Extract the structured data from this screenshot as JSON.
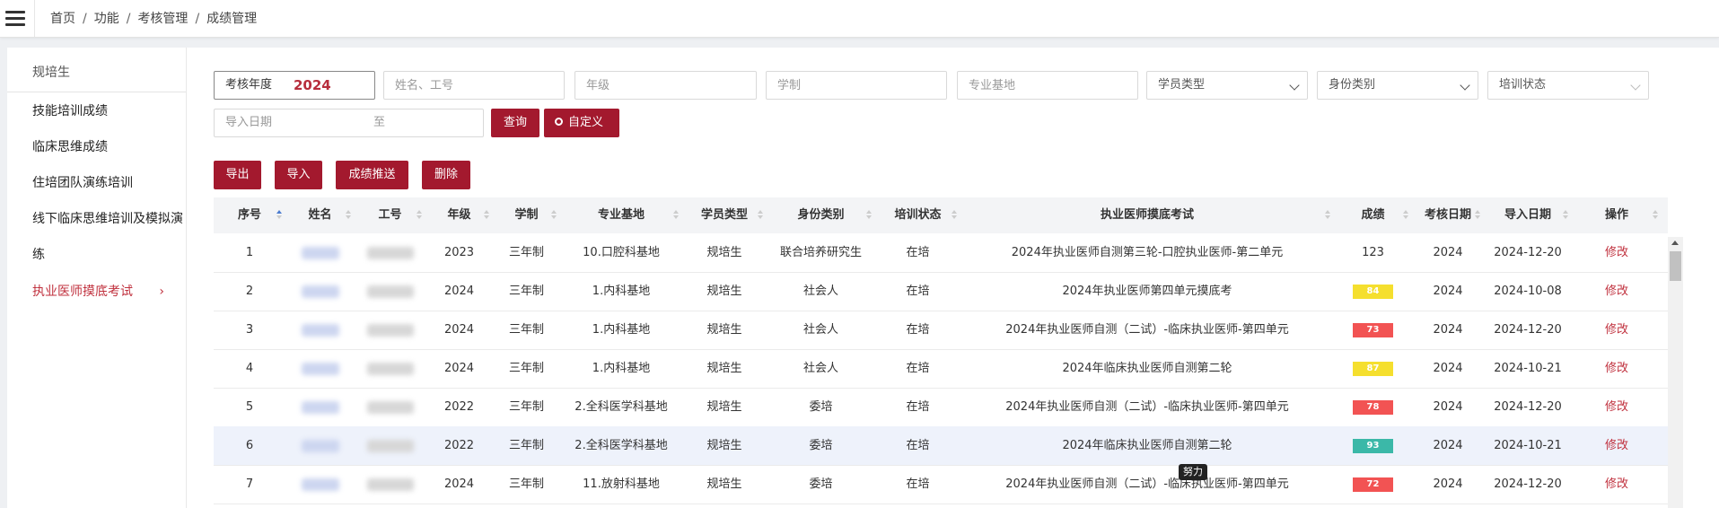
{
  "breadcrumb": [
    "首页",
    "功能",
    "考核管理",
    "成绩管理"
  ],
  "sidebar": {
    "header": "规培生",
    "items": [
      {
        "label": "技能培训成绩"
      },
      {
        "label": "临床思维成绩"
      },
      {
        "label": "住培团队演练培训"
      },
      {
        "label": "线下临床思维培训及模拟演"
      },
      {
        "label": "练"
      },
      {
        "label": "执业医师摸底考试",
        "active": true
      }
    ],
    "chevron": "›"
  },
  "filters": {
    "year_label": "考核年度",
    "year_value": "2024",
    "name_placeholder": "姓名、工号",
    "grade_placeholder": "年级",
    "system_placeholder": "学制",
    "base_placeholder": "专业基地",
    "student_type": "学员类型",
    "identity": "身份类别",
    "status": "培训状态",
    "import_date_label": "导入日期",
    "to_label": "至"
  },
  "buttons": {
    "query": "查询",
    "custom": "自定义",
    "export": "导出",
    "import": "导入",
    "push": "成绩推送",
    "delete": "删除"
  },
  "table": {
    "columns": [
      "序号",
      "姓名",
      "工号",
      "年级",
      "学制",
      "专业基地",
      "学员类型",
      "身份类别",
      "培训状态",
      "执业医师摸底考试",
      "成绩",
      "考核日期",
      "导入日期",
      "操作"
    ],
    "rows": [
      {
        "no": "1",
        "grade": "2023",
        "system": "三年制",
        "base": "10.口腔科基地",
        "stype": "规培生",
        "identity": "联合培养研究生",
        "status": "在培",
        "exam": "2024年执业医师自测第三轮-口腔执业医师-第二单元",
        "score": "123",
        "score_color": "",
        "exam_year": "2024",
        "import_date": "2024-12-20",
        "action": "修改"
      },
      {
        "no": "2",
        "grade": "2024",
        "system": "三年制",
        "base": "1.内科基地",
        "stype": "规培生",
        "identity": "社会人",
        "status": "在培",
        "exam": "2024年执业医师第四单元摸底考",
        "score": "84",
        "score_color": "#f5df2e",
        "exam_year": "2024",
        "import_date": "2024-10-08",
        "action": "修改"
      },
      {
        "no": "3",
        "grade": "2024",
        "system": "三年制",
        "base": "1.内科基地",
        "stype": "规培生",
        "identity": "社会人",
        "status": "在培",
        "exam": "2024年执业医师自测（二试）-临床执业医师-第四单元",
        "score": "73",
        "score_color": "#f25353",
        "exam_year": "2024",
        "import_date": "2024-12-20",
        "action": "修改"
      },
      {
        "no": "4",
        "grade": "2024",
        "system": "三年制",
        "base": "1.内科基地",
        "stype": "规培生",
        "identity": "社会人",
        "status": "在培",
        "exam": "2024年临床执业医师自测第二轮",
        "score": "87",
        "score_color": "#f5df2e",
        "exam_year": "2024",
        "import_date": "2024-10-21",
        "action": "修改"
      },
      {
        "no": "5",
        "grade": "2022",
        "system": "三年制",
        "base": "2.全科医学科基地",
        "stype": "规培生",
        "identity": "委培",
        "status": "在培",
        "exam": "2024年执业医师自测（二试）-临床执业医师-第四单元",
        "score": "78",
        "score_color": "#f25353",
        "exam_year": "2024",
        "import_date": "2024-12-20",
        "action": "修改"
      },
      {
        "no": "6",
        "grade": "2022",
        "system": "三年制",
        "base": "2.全科医学科基地",
        "stype": "规培生",
        "identity": "委培",
        "status": "在培",
        "exam": "2024年临床执业医师自测第二轮",
        "score": "93",
        "score_color": "#3bb8a8",
        "exam_year": "2024",
        "import_date": "2024-10-21",
        "action": "修改"
      },
      {
        "no": "7",
        "grade": "2024",
        "system": "三年制",
        "base": "11.放射科基地",
        "stype": "规培生",
        "identity": "委培",
        "status": "在培",
        "exam": "2024年执业医师自测（二试）-临床执业医师-第四单元",
        "score": "72",
        "score_color": "#f25353",
        "exam_year": "2024",
        "import_date": "2024-12-20",
        "action": "修改"
      }
    ],
    "tooltip": "努力"
  }
}
